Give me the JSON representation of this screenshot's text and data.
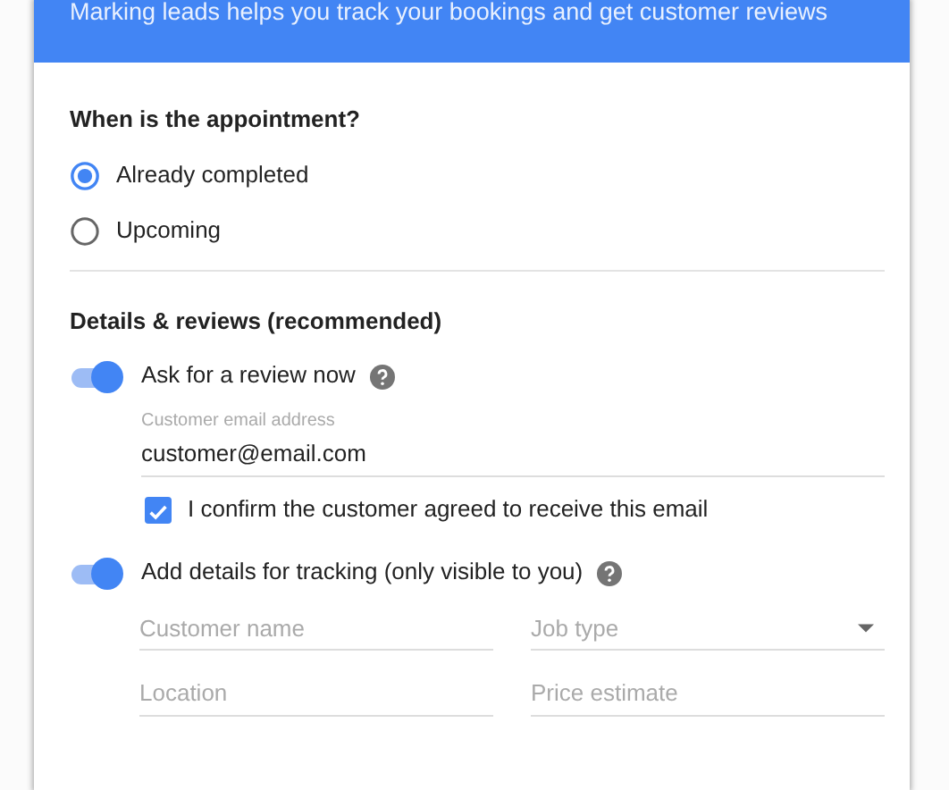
{
  "header": {
    "text": "Marking leads helps you track your bookings and get customer reviews"
  },
  "appointment": {
    "title": "When is the appointment?",
    "options": [
      {
        "label": "Already completed",
        "selected": true
      },
      {
        "label": "Upcoming",
        "selected": false
      }
    ]
  },
  "details": {
    "title": "Details & reviews (recommended)",
    "review_toggle": {
      "label": "Ask for a review now",
      "on": true
    },
    "email": {
      "label": "Customer email address",
      "value": "customer@email.com"
    },
    "confirm": {
      "label": "I confirm the customer agreed to receive this email",
      "checked": true
    },
    "tracking_toggle": {
      "label": "Add details for tracking (only visible to you)",
      "on": true
    },
    "fields": [
      {
        "kind": "text",
        "placeholder": "Customer name"
      },
      {
        "kind": "select",
        "placeholder": "Job type"
      },
      {
        "kind": "text",
        "placeholder": "Location"
      },
      {
        "kind": "text",
        "placeholder": "Price estimate"
      }
    ]
  }
}
